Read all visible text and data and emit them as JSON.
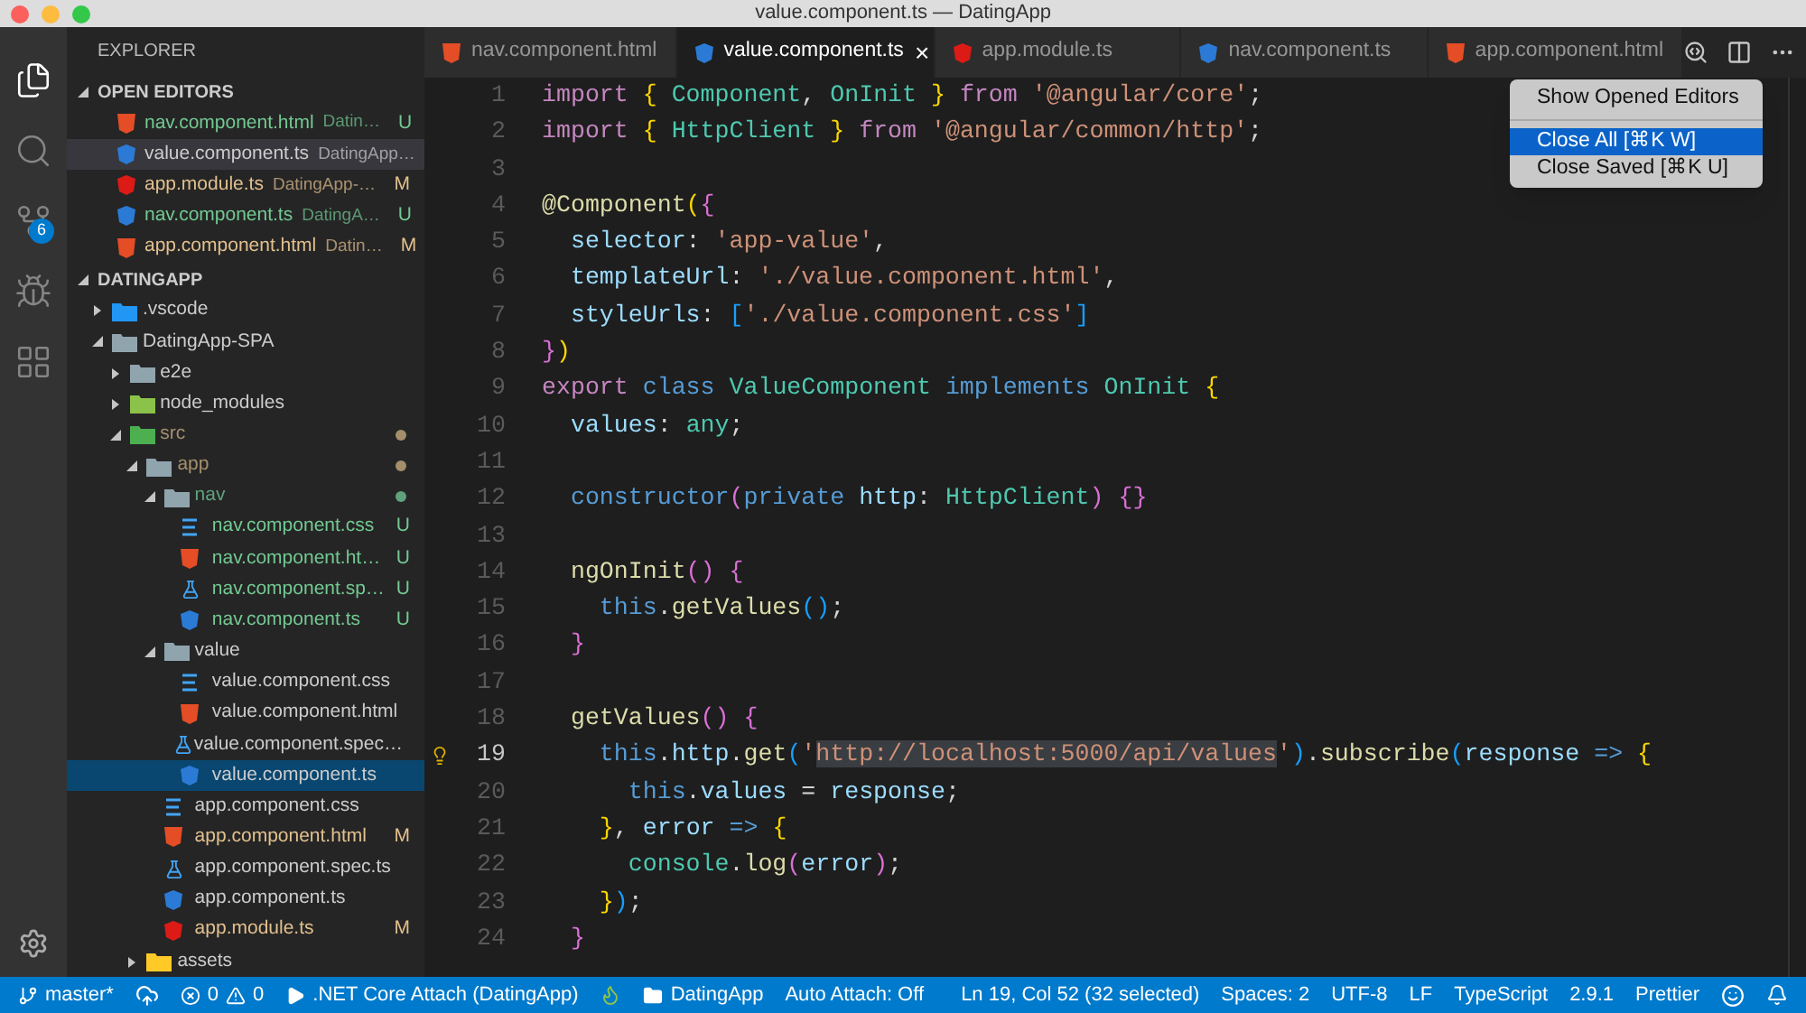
{
  "window": {
    "title": "value.component.ts — DatingApp"
  },
  "activity_bar": {
    "items": [
      {
        "kind": "files",
        "selected": true
      },
      {
        "kind": "search",
        "selected": false
      },
      {
        "kind": "scm",
        "selected": false,
        "badge": "6"
      },
      {
        "kind": "debug",
        "selected": false
      },
      {
        "kind": "extensions",
        "selected": false
      }
    ]
  },
  "explorer": {
    "title": "EXPLORER",
    "open_editors": {
      "title": "OPEN EDITORS",
      "expanded": true,
      "items": [
        {
          "name": "nav.component.html",
          "description": "Datin…",
          "status": "U",
          "color": "#73c991",
          "kind": "html",
          "selected": false
        },
        {
          "name": "value.component.ts",
          "description": "DatingApp…",
          "kind": "angular",
          "selected": true
        },
        {
          "name": "app.module.ts",
          "description": "DatingApp-…",
          "status": "M",
          "color": "#e2c08d",
          "kind": "module",
          "selected": false
        },
        {
          "name": "nav.component.ts",
          "description": "DatingA…",
          "status": "U",
          "color": "#73c991",
          "kind": "angular",
          "selected": false
        },
        {
          "name": "app.component.html",
          "description": "Datin…",
          "status": "M",
          "color": "#e2c08d",
          "kind": "html",
          "selected": false
        }
      ]
    },
    "folder": {
      "title": "DATINGAPP",
      "expanded": true
    },
    "tree": [
      {
        "name": ".vscode",
        "kind": "folder-vscode",
        "expanded": false,
        "selected": false
      },
      {
        "name": "DatingApp-SPA",
        "kind": "folder",
        "expanded": true,
        "selected": false,
        "children": [
          {
            "name": "e2e",
            "kind": "folder",
            "expanded": false,
            "selected": false
          },
          {
            "name": "node_modules",
            "kind": "folder-node",
            "expanded": false,
            "selected": false
          },
          {
            "name": "src",
            "kind": "folder-src",
            "expanded": true,
            "selected": false,
            "color": "#a58f6b",
            "children": [
              {
                "name": "app",
                "kind": "folder",
                "expanded": true,
                "selected": false,
                "color": "#a58f6b",
                "children": [
                  {
                    "name": "nav",
                    "kind": "folder",
                    "expanded": true,
                    "selected": false,
                    "color": "#5fa27c",
                    "children": [
                      {
                        "name": "nav.component.css",
                        "kind": "css",
                        "selected": false,
                        "color": "#73c991",
                        "status": "U"
                      },
                      {
                        "name": "nav.component.ht…",
                        "kind": "html",
                        "selected": false,
                        "color": "#73c991",
                        "status": "U"
                      },
                      {
                        "name": "nav.component.sp…",
                        "kind": "spec",
                        "selected": false,
                        "color": "#73c991",
                        "status": "U"
                      },
                      {
                        "name": "nav.component.ts",
                        "kind": "angular",
                        "selected": false,
                        "color": "#73c991",
                        "status": "U"
                      }
                    ]
                  },
                  {
                    "name": "value",
                    "kind": "folder",
                    "expanded": true,
                    "selected": false,
                    "children": [
                      {
                        "name": "value.component.css",
                        "kind": "css",
                        "selected": false
                      },
                      {
                        "name": "value.component.html",
                        "kind": "html",
                        "selected": false
                      },
                      {
                        "name": "value.component.spec…",
                        "kind": "spec",
                        "selected": false
                      },
                      {
                        "name": "value.component.ts",
                        "kind": "angular",
                        "selected": true
                      }
                    ]
                  },
                  {
                    "name": "app.component.css",
                    "kind": "css",
                    "selected": false
                  },
                  {
                    "name": "app.component.html",
                    "kind": "html",
                    "selected": false,
                    "color": "#e2c08d",
                    "status": "M"
                  },
                  {
                    "name": "app.component.spec.ts",
                    "kind": "spec",
                    "selected": false
                  },
                  {
                    "name": "app.component.ts",
                    "kind": "angular",
                    "selected": false
                  },
                  {
                    "name": "app.module.ts",
                    "kind": "module",
                    "selected": false,
                    "color": "#e2c08d",
                    "status": "M"
                  }
                ]
              },
              {
                "name": "assets",
                "kind": "folder-assets",
                "expanded": false,
                "selected": false
              }
            ]
          }
        ]
      }
    ]
  },
  "tabs": [
    {
      "label": "nav.component.html",
      "kind": "html",
      "selected": false
    },
    {
      "label": "value.component.ts",
      "kind": "angular",
      "selected": true,
      "close": "×"
    },
    {
      "label": "app.module.ts",
      "kind": "module",
      "selected": false
    },
    {
      "label": "nav.component.ts",
      "kind": "angular",
      "selected": false
    },
    {
      "label": "app.component.html",
      "kind": "html",
      "selected": false
    }
  ],
  "menu": {
    "groups": [
      {
        "items": [
          {
            "label": "Show Opened Editors",
            "selected": false
          }
        ]
      },
      {
        "items": [
          {
            "label": "Close All [⌘K W]",
            "selected": true
          },
          {
            "label": "Close Saved [⌘K U]",
            "selected": false
          }
        ]
      }
    ]
  },
  "editor": {
    "lines": [
      {
        "number": "1",
        "current": false,
        "tokens": [
          {
            "text": "import ",
            "kind": "kw"
          },
          {
            "text": "{ ",
            "kind": "b1"
          },
          {
            "text": "Component",
            "kind": "ty"
          },
          {
            "text": ", ",
            "kind": "d"
          },
          {
            "text": "OnInit ",
            "kind": "ty"
          },
          {
            "text": "} ",
            "kind": "b1"
          },
          {
            "text": "from ",
            "kind": "kw"
          },
          {
            "text": "'@angular/core'",
            "kind": "s"
          },
          {
            "text": ";",
            "kind": "d"
          }
        ]
      },
      {
        "number": "2",
        "current": false,
        "tokens": [
          {
            "text": "import ",
            "kind": "kw"
          },
          {
            "text": "{ ",
            "kind": "b1"
          },
          {
            "text": "HttpClient ",
            "kind": "ty"
          },
          {
            "text": "} ",
            "kind": "b1"
          },
          {
            "text": "from ",
            "kind": "kw"
          },
          {
            "text": "'@angular/common/http'",
            "kind": "s"
          },
          {
            "text": ";",
            "kind": "d"
          }
        ]
      },
      {
        "number": "3",
        "current": false
      },
      {
        "number": "4",
        "current": false,
        "tokens": [
          {
            "text": "@Component",
            "kind": "f"
          },
          {
            "text": "(",
            "kind": "b1"
          },
          {
            "text": "{",
            "kind": "b2"
          }
        ]
      },
      {
        "number": "5",
        "current": false,
        "tokens": [
          {
            "text": "  selector",
            "kind": "p"
          },
          {
            "text": ": ",
            "kind": "d"
          },
          {
            "text": "'app-value'",
            "kind": "s"
          },
          {
            "text": ",",
            "kind": "d"
          }
        ]
      },
      {
        "number": "6",
        "current": false,
        "tokens": [
          {
            "text": "  templateUrl",
            "kind": "p"
          },
          {
            "text": ": ",
            "kind": "d"
          },
          {
            "text": "'./value.component.html'",
            "kind": "s"
          },
          {
            "text": ",",
            "kind": "d"
          }
        ]
      },
      {
        "number": "7",
        "current": false,
        "tokens": [
          {
            "text": "  styleUrls",
            "kind": "p"
          },
          {
            "text": ": ",
            "kind": "d"
          },
          {
            "text": "[",
            "kind": "b3"
          },
          {
            "text": "'./value.component.css'",
            "kind": "s"
          },
          {
            "text": "]",
            "kind": "b3"
          }
        ]
      },
      {
        "number": "8",
        "current": false,
        "tokens": [
          {
            "text": "}",
            "kind": "b2"
          },
          {
            "text": ")",
            "kind": "b1"
          }
        ]
      },
      {
        "number": "9",
        "current": false,
        "tokens": [
          {
            "text": "export ",
            "kind": "kw"
          },
          {
            "text": "class ",
            "kind": "st"
          },
          {
            "text": "ValueComponent ",
            "kind": "ty"
          },
          {
            "text": "implements ",
            "kind": "st"
          },
          {
            "text": "OnInit ",
            "kind": "ty"
          },
          {
            "text": "{",
            "kind": "b1"
          }
        ]
      },
      {
        "number": "10",
        "current": false,
        "tokens": [
          {
            "text": "  values",
            "kind": "p"
          },
          {
            "text": ": ",
            "kind": "d"
          },
          {
            "text": "any",
            "kind": "ty"
          },
          {
            "text": ";",
            "kind": "d"
          }
        ]
      },
      {
        "number": "11",
        "current": false
      },
      {
        "number": "12",
        "current": false,
        "tokens": [
          {
            "text": "  constructor",
            "kind": "st"
          },
          {
            "text": "(",
            "kind": "b2"
          },
          {
            "text": "private ",
            "kind": "st"
          },
          {
            "text": "http",
            "kind": "p"
          },
          {
            "text": ": ",
            "kind": "d"
          },
          {
            "text": "HttpClient",
            "kind": "ty"
          },
          {
            "text": ") ",
            "kind": "b2"
          },
          {
            "text": "{}",
            "kind": "b2"
          }
        ]
      },
      {
        "number": "13",
        "current": false
      },
      {
        "number": "14",
        "current": false,
        "tokens": [
          {
            "text": "  ngOnInit",
            "kind": "f"
          },
          {
            "text": "() ",
            "kind": "b2"
          },
          {
            "text": "{",
            "kind": "b2"
          }
        ]
      },
      {
        "number": "15",
        "current": false,
        "tokens": [
          {
            "text": "    this",
            "kind": "st"
          },
          {
            "text": ".",
            "kind": "d"
          },
          {
            "text": "getValues",
            "kind": "f"
          },
          {
            "text": "()",
            "kind": "b3"
          },
          {
            "text": ";",
            "kind": "d"
          }
        ]
      },
      {
        "number": "16",
        "current": false,
        "tokens": [
          {
            "text": "  }",
            "kind": "b2"
          }
        ]
      },
      {
        "number": "17",
        "current": false
      },
      {
        "number": "18",
        "current": false,
        "tokens": [
          {
            "text": "  getValues",
            "kind": "f"
          },
          {
            "text": "() ",
            "kind": "b2"
          },
          {
            "text": "{",
            "kind": "b2"
          }
        ]
      },
      {
        "number": "19",
        "current": true,
        "lightbulb": true,
        "tokens": [
          {
            "text": "    this",
            "kind": "st"
          },
          {
            "text": ".",
            "kind": "d"
          },
          {
            "text": "http",
            "kind": "p"
          },
          {
            "text": ".",
            "kind": "d"
          },
          {
            "text": "get",
            "kind": "f"
          },
          {
            "text": "(",
            "kind": "b3"
          },
          {
            "text": "'",
            "kind": "s"
          },
          {
            "text": "http://localhost:5000/api/values",
            "kind": "sel"
          },
          {
            "text": "'",
            "kind": "s"
          },
          {
            "text": ")",
            "kind": "b3"
          },
          {
            "text": ".",
            "kind": "d"
          },
          {
            "text": "subscribe",
            "kind": "f"
          },
          {
            "text": "(",
            "kind": "b3"
          },
          {
            "text": "response ",
            "kind": "p"
          },
          {
            "text": "=> ",
            "kind": "st"
          },
          {
            "text": "{",
            "kind": "b1"
          }
        ]
      },
      {
        "number": "20",
        "current": false,
        "tokens": [
          {
            "text": "      this",
            "kind": "st"
          },
          {
            "text": ".",
            "kind": "d"
          },
          {
            "text": "values ",
            "kind": "p"
          },
          {
            "text": "= ",
            "kind": "d"
          },
          {
            "text": "response",
            "kind": "p"
          },
          {
            "text": ";",
            "kind": "d"
          }
        ]
      },
      {
        "number": "21",
        "current": false,
        "tokens": [
          {
            "text": "    }",
            "kind": "b1"
          },
          {
            "text": ", ",
            "kind": "d"
          },
          {
            "text": "error ",
            "kind": "p"
          },
          {
            "text": "=> ",
            "kind": "st"
          },
          {
            "text": "{",
            "kind": "b1"
          }
        ]
      },
      {
        "number": "22",
        "current": false,
        "tokens": [
          {
            "text": "      console",
            "kind": "ty"
          },
          {
            "text": ".",
            "kind": "d"
          },
          {
            "text": "log",
            "kind": "f"
          },
          {
            "text": "(",
            "kind": "b2"
          },
          {
            "text": "error",
            "kind": "p"
          },
          {
            "text": ")",
            "kind": "b2"
          },
          {
            "text": ";",
            "kind": "d"
          }
        ]
      },
      {
        "number": "23",
        "current": false,
        "tokens": [
          {
            "text": "    }",
            "kind": "b1"
          },
          {
            "text": ")",
            "kind": "b3"
          },
          {
            "text": ";",
            "kind": "d"
          }
        ]
      },
      {
        "number": "24",
        "current": false,
        "tokens": [
          {
            "text": "  }",
            "kind": "b2"
          }
        ]
      }
    ]
  },
  "status_bar": {
    "left": [
      {
        "kind": "branch",
        "text": "master*"
      },
      {
        "kind": "sync"
      },
      {
        "kind": "problems",
        "errors": "0",
        "warnings": "0"
      },
      {
        "kind": "debug",
        "text": ".NET Core Attach (DatingApp)"
      },
      {
        "kind": "flame"
      },
      {
        "kind": "folder",
        "text": "DatingApp"
      },
      {
        "kind": "plain",
        "text": "Auto Attach: Off"
      }
    ],
    "right": [
      {
        "kind": "plain",
        "text": "Ln 19, Col 52 (32 selected)"
      },
      {
        "kind": "plain",
        "text": "Spaces: 2"
      },
      {
        "kind": "plain",
        "text": "UTF-8"
      },
      {
        "kind": "plain",
        "text": "LF"
      },
      {
        "kind": "plain",
        "text": "TypeScript"
      },
      {
        "kind": "plain",
        "text": "2.9.1"
      },
      {
        "kind": "plain",
        "text": "Prettier"
      },
      {
        "kind": "feedback"
      },
      {
        "kind": "bell"
      }
    ]
  }
}
